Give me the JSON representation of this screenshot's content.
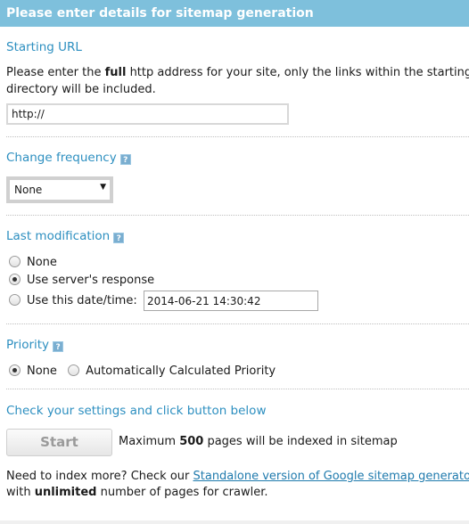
{
  "header": {
    "title": "Please enter details for sitemap generation"
  },
  "starting_url": {
    "title": "Starting URL",
    "desc_before": "Please enter the ",
    "desc_bold": "full",
    "desc_after": " http address for your site, only the links within the starting",
    "desc_line2": "directory will be included.",
    "value": "http://"
  },
  "change_frequency": {
    "title": "Change frequency",
    "help_icon": "?",
    "selected": "None"
  },
  "last_modification": {
    "title": "Last modification",
    "help_icon": "?",
    "options": [
      "None",
      "Use server's response",
      "Use this date/time:"
    ],
    "selected_index": 1,
    "date_value": "2014-06-21 14:30:42"
  },
  "priority": {
    "title": "Priority",
    "help_icon": "?",
    "options": [
      "None",
      "Automatically Calculated Priority"
    ],
    "selected_index": 0
  },
  "submit": {
    "title": "Check your settings and click button below",
    "button_label": "Start",
    "note_before": "Maximum ",
    "note_bold": "500",
    "note_after": " pages will be indexed in sitemap"
  },
  "footer": {
    "line1_before": "Need to index more? Check our ",
    "link_text": "Standalone version of Google sitemap generator",
    "line2_before": "with ",
    "line2_bold": "unlimited",
    "line2_after": " number of pages for crawler."
  },
  "colors": {
    "header_bg": "#7ec0dc",
    "section_title": "#2d8fc0",
    "link": "#1f7aad"
  }
}
